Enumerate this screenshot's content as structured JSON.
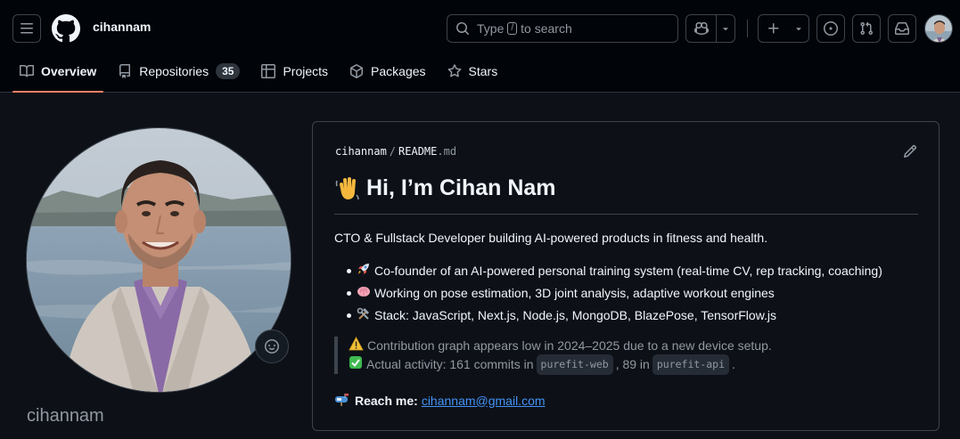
{
  "header": {
    "username": "cihannam",
    "search": {
      "prefix": "Type",
      "kbd": "/",
      "suffix": "to search"
    }
  },
  "tabs": [
    {
      "label": "Overview",
      "icon": "book-icon",
      "active": true
    },
    {
      "label": "Repositories",
      "icon": "repo-icon",
      "count": "35"
    },
    {
      "label": "Projects",
      "icon": "table-icon"
    },
    {
      "label": "Packages",
      "icon": "package-icon"
    },
    {
      "label": "Stars",
      "icon": "star-icon"
    }
  ],
  "profile": {
    "username": "cihannam"
  },
  "readme": {
    "path_owner": "cihannam",
    "path_sep": "/",
    "path_file": "README",
    "path_ext": ".md",
    "heading": "Hi, I’m Cihan Nam",
    "heading_emoji": "waving-hand",
    "intro": "CTO & Fullstack Developer building AI-powered products in fitness and health.",
    "bullets": [
      {
        "emoji": "rocket",
        "text": "Co-founder of an AI-powered personal training system (real-time CV, rep tracking, coaching)"
      },
      {
        "emoji": "brain",
        "text": "Working on pose estimation, 3D joint analysis, adaptive workout engines"
      },
      {
        "emoji": "hammer-and-wrench",
        "text": "Stack: JavaScript, Next.js, Node.js, MongoDB, BlazePose, TensorFlow.js"
      }
    ],
    "note": {
      "line1": "Contribution graph appears low in 2024–2025 due to a new device setup.",
      "line2_pre": "Actual activity: 161 commits in",
      "repo1": "purefit-web",
      "line2_mid": ", 89 in",
      "repo2": "purefit-api",
      "line2_end": "."
    },
    "reach_label": "Reach me:",
    "email": "cihannam@gmail.com"
  },
  "colors": {
    "background": "#0d1117",
    "header": "#010409",
    "border": "#3d444d",
    "text": "#f0f6fc",
    "muted": "#9198a1",
    "link": "#4493f8",
    "tab_underline": "#f78166"
  }
}
